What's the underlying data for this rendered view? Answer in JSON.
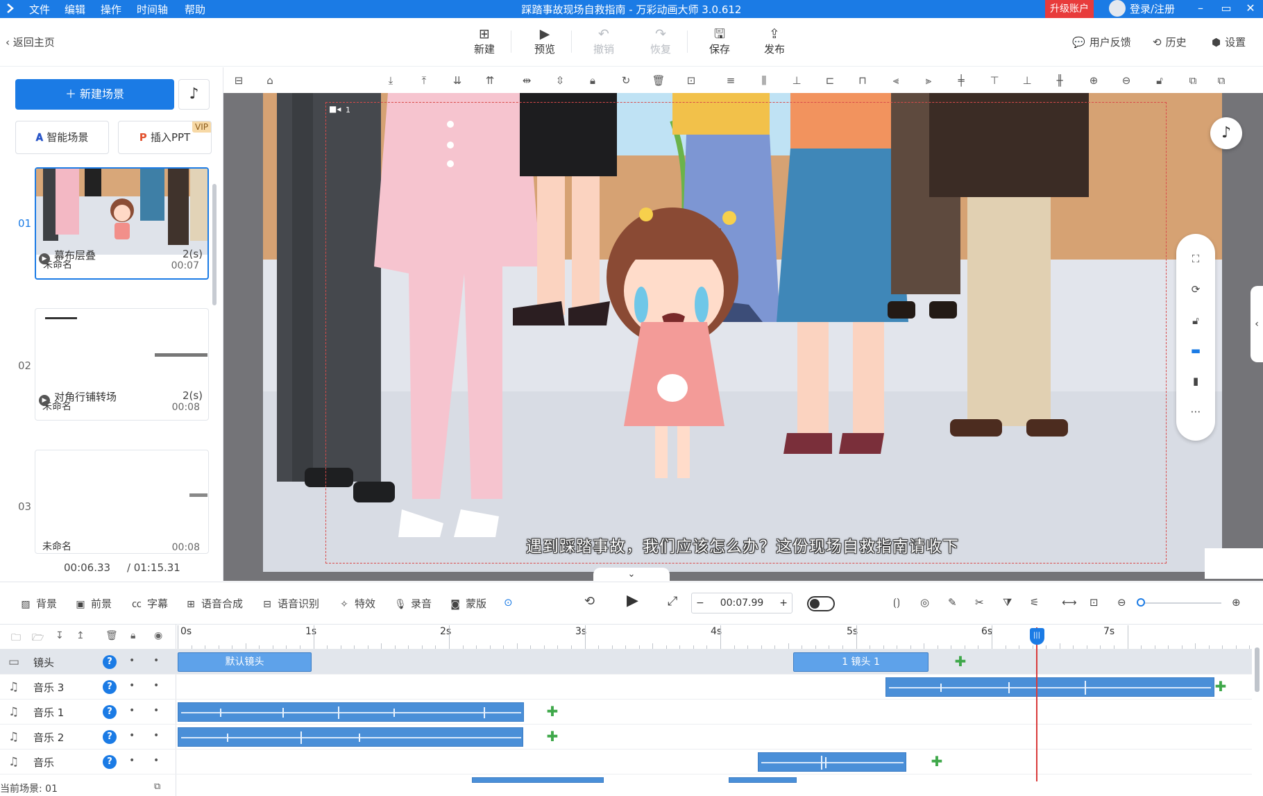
{
  "titlebar": {
    "menus": [
      "文件",
      "编辑",
      "操作",
      "时间轴",
      "帮助"
    ],
    "title": "踩踏事故现场自救指南 - 万彩动画大师 3.0.612",
    "upgrade": "升级账户",
    "login": "登录/注册",
    "accent_color": "#1b7be5"
  },
  "toolbar": {
    "back": "返回主页",
    "buttons": [
      {
        "label": "新建",
        "icon": "new-icon"
      },
      {
        "label": "预览",
        "icon": "play-icon"
      },
      {
        "label": "撤销",
        "icon": "undo-icon",
        "disabled": true
      },
      {
        "label": "恢复",
        "icon": "redo-icon",
        "disabled": true
      },
      {
        "label": "保存",
        "icon": "save-icon"
      },
      {
        "label": "发布",
        "icon": "publish-icon"
      }
    ],
    "right": [
      {
        "label": "用户反馈",
        "icon": "feedback-icon"
      },
      {
        "label": "历史",
        "icon": "history-icon"
      },
      {
        "label": "设置",
        "icon": "settings-icon"
      }
    ]
  },
  "left_panel": {
    "new_scene": "新建场景",
    "smart_scene": "智能场景",
    "insert_ppt": "插入PPT",
    "vip": "VIP",
    "scenes": [
      {
        "num": "01",
        "name": "未命名",
        "duration": "00:07",
        "active": true
      },
      {
        "num": "02",
        "name": "未命名",
        "duration": "00:08",
        "active": false
      },
      {
        "num": "03",
        "name": "未命名",
        "duration": "00:08",
        "active": false
      }
    ],
    "transitions": [
      {
        "name": "幕布层叠",
        "duration": "2(s)"
      },
      {
        "name": "对角行铺转场",
        "duration": "2(s)"
      }
    ],
    "current_time": "00:06.33",
    "total_time": "/ 01:15.31"
  },
  "canvas": {
    "caption": "遇到踩踏事故，我们应该怎么办？这份现场自救指南请收下",
    "camera_label": "1"
  },
  "bottom_toolbar": {
    "items": [
      "背景",
      "前景",
      "字幕",
      "语音合成",
      "语音识别",
      "特效",
      "录音",
      "蒙版"
    ],
    "time": "00:07.99"
  },
  "timeline": {
    "ruler": [
      "0s",
      "1s",
      "2s",
      "3s",
      "4s",
      "5s",
      "6s",
      "7s"
    ],
    "playhead_seconds": 6.33,
    "tracks": [
      {
        "name": "镜头",
        "icon": "camera-icon"
      },
      {
        "name": "音乐 3",
        "icon": "music-note-icon"
      },
      {
        "name": "音乐 1",
        "icon": "music-note-icon"
      },
      {
        "name": "音乐 2",
        "icon": "music-note-icon"
      },
      {
        "name": "音乐",
        "icon": "music-note-icon"
      }
    ],
    "camera_clips": [
      "默认镜头",
      "1 镜头 1"
    ],
    "current_scene": "当前场景: 01"
  }
}
